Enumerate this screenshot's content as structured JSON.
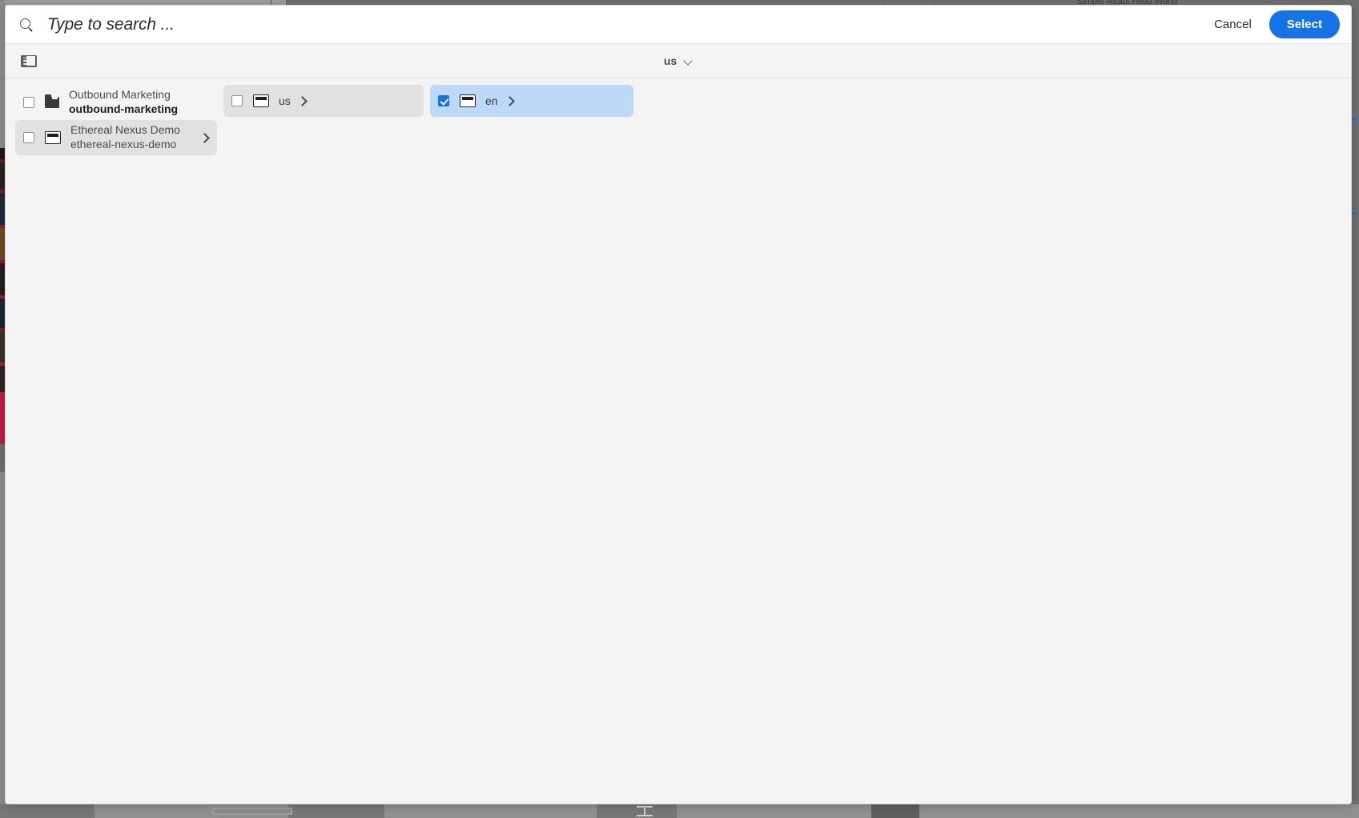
{
  "background": {
    "app_title": "Simple React Hello World"
  },
  "dialog": {
    "search": {
      "placeholder": "Type to search ...",
      "value": "",
      "icon": "search-icon"
    },
    "actions": {
      "cancel_label": "Cancel",
      "select_label": "Select"
    },
    "toolbar": {
      "view_toggle_icon": "sidebar-rail-icon",
      "breadcrumb_label": "us",
      "breadcrumb_icon": "chevron-down-icon"
    },
    "columns": [
      {
        "name": "column-root",
        "items": [
          {
            "title": "Outbound Marketing",
            "subtitle": "outbound-marketing",
            "subtitle_bold": true,
            "icon": "folder-icon",
            "checked": false,
            "selected": "none",
            "has_children": false
          },
          {
            "title": "Ethereal Nexus Demo",
            "subtitle": "ethereal-nexus-demo",
            "subtitle_bold": false,
            "icon": "page-icon",
            "checked": false,
            "selected": "gray",
            "has_children": true
          }
        ]
      },
      {
        "name": "column-site",
        "items": [
          {
            "title": "us",
            "subtitle": "",
            "subtitle_bold": false,
            "icon": "page-icon",
            "checked": false,
            "selected": "gray",
            "has_children": true
          }
        ]
      },
      {
        "name": "column-language",
        "items": [
          {
            "title": "en",
            "subtitle": "",
            "subtitle_bold": false,
            "icon": "page-icon",
            "checked": true,
            "selected": "blue",
            "has_children": true
          }
        ]
      }
    ]
  },
  "colors": {
    "accent_blue": "#1473e6",
    "selection_blue": "#bcd9f7",
    "selection_gray": "#e1e1e1",
    "panel_bg": "#f4f4f4",
    "search_bg": "#ffffff"
  }
}
